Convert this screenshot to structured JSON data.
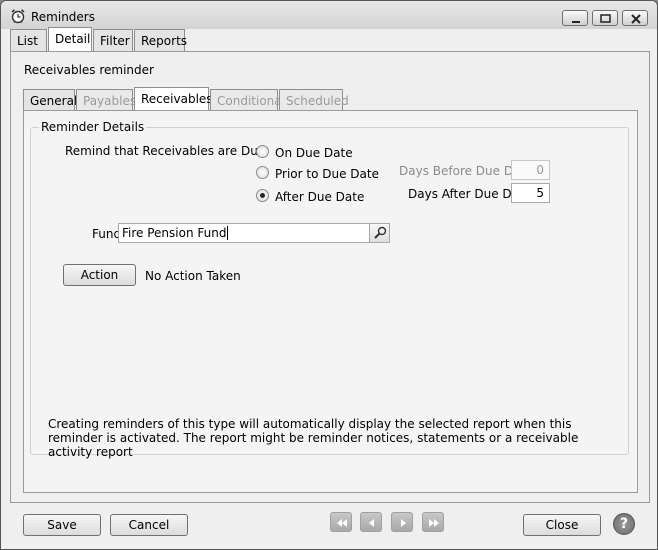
{
  "window": {
    "title": "Reminders"
  },
  "tabs": [
    "List",
    "Detail",
    "Filter",
    "Reports"
  ],
  "detail": {
    "heading": "Receivables reminder",
    "inner_tabs": [
      "General",
      "Payables",
      "Receivables",
      "Conditional",
      "Scheduled"
    ],
    "group_title": "Reminder Details",
    "remind_label": "Remind that Receivables are Due:",
    "radio_options": [
      "On Due Date",
      "Prior to Due Date",
      "After Due Date"
    ],
    "selected_option": "After Due Date",
    "days_before_label": "Days Before Due Date",
    "days_before_value": "0",
    "days_after_label": "Days After Due Date",
    "days_after_value": "5",
    "fund_label": "Fund",
    "fund_value": "Fire Pension Fund",
    "action_button": "Action",
    "action_status": "No Action Taken",
    "info_text": "Creating reminders of this type will automatically display the selected report when this reminder is activated.  The report might be reminder notices, statements or a receivable activity report"
  },
  "footer": {
    "save": "Save",
    "cancel": "Cancel",
    "close": "Close",
    "help": "?",
    "nav_icons": [
      "first-record-icon",
      "previous-record-icon",
      "next-record-icon",
      "last-record-icon"
    ]
  }
}
